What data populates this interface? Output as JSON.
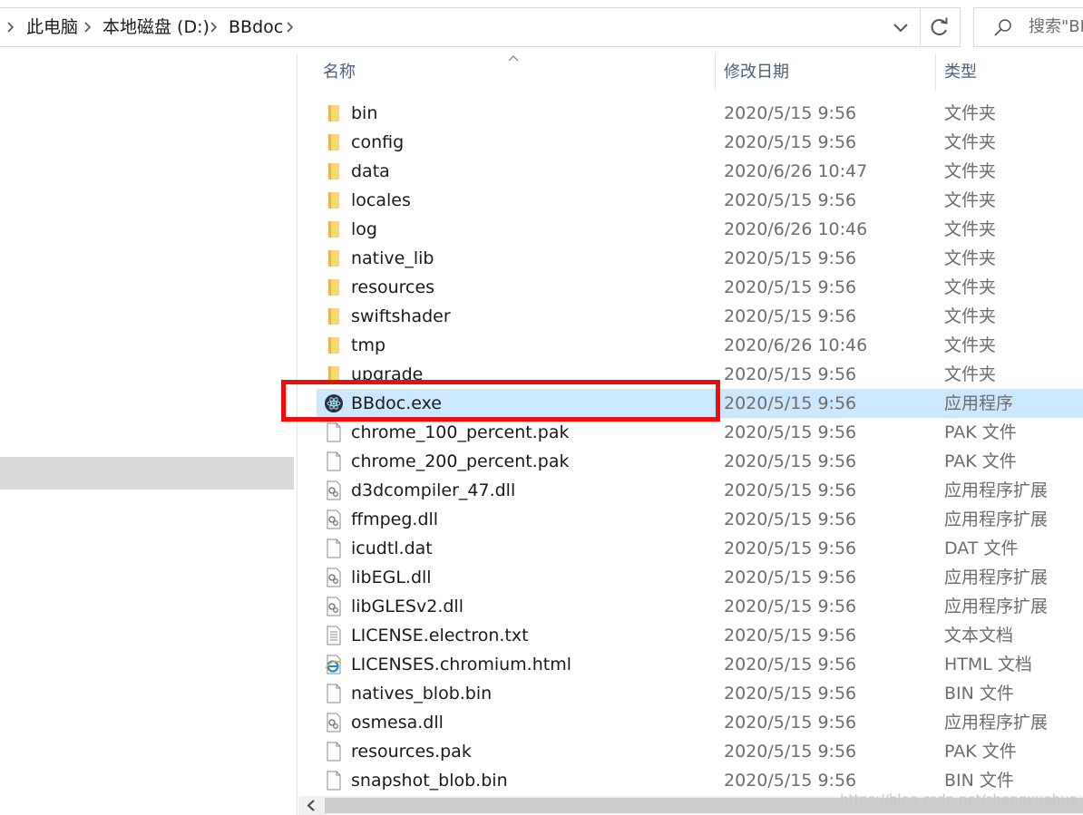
{
  "breadcrumb": {
    "items": [
      "此电脑",
      "本地磁盘 (D:)",
      "BBdoc"
    ]
  },
  "search": {
    "placeholder": "搜索\"BBdoc\"",
    "visible_text": "搜索\"BB"
  },
  "columns": {
    "name": "名称",
    "date": "修改日期",
    "type": "类型"
  },
  "files": [
    {
      "name": "bin",
      "date": "2020/5/15 9:56",
      "type": "文件夹",
      "icon": "folder-icon"
    },
    {
      "name": "config",
      "date": "2020/5/15 9:56",
      "type": "文件夹",
      "icon": "folder-icon"
    },
    {
      "name": "data",
      "date": "2020/6/26 10:47",
      "type": "文件夹",
      "icon": "folder-icon"
    },
    {
      "name": "locales",
      "date": "2020/5/15 9:56",
      "type": "文件夹",
      "icon": "folder-icon"
    },
    {
      "name": "log",
      "date": "2020/6/26 10:46",
      "type": "文件夹",
      "icon": "folder-icon"
    },
    {
      "name": "native_lib",
      "date": "2020/5/15 9:56",
      "type": "文件夹",
      "icon": "folder-icon"
    },
    {
      "name": "resources",
      "date": "2020/5/15 9:56",
      "type": "文件夹",
      "icon": "folder-icon"
    },
    {
      "name": "swiftshader",
      "date": "2020/5/15 9:56",
      "type": "文件夹",
      "icon": "folder-icon"
    },
    {
      "name": "tmp",
      "date": "2020/6/26 10:46",
      "type": "文件夹",
      "icon": "folder-icon"
    },
    {
      "name": "upgrade",
      "date": "2020/5/15 9:56",
      "type": "文件夹",
      "icon": "folder-icon"
    },
    {
      "name": "BBdoc.exe",
      "date": "2020/5/15 9:56",
      "type": "应用程序",
      "icon": "app-icon",
      "selected": true,
      "highlighted": true
    },
    {
      "name": "chrome_100_percent.pak",
      "date": "2020/5/15 9:56",
      "type": "PAK 文件",
      "icon": "file-icon"
    },
    {
      "name": "chrome_200_percent.pak",
      "date": "2020/5/15 9:56",
      "type": "PAK 文件",
      "icon": "file-icon"
    },
    {
      "name": "d3dcompiler_47.dll",
      "date": "2020/5/15 9:56",
      "type": "应用程序扩展",
      "icon": "dll-icon"
    },
    {
      "name": "ffmpeg.dll",
      "date": "2020/5/15 9:56",
      "type": "应用程序扩展",
      "icon": "dll-icon"
    },
    {
      "name": "icudtl.dat",
      "date": "2020/5/15 9:56",
      "type": "DAT 文件",
      "icon": "file-icon"
    },
    {
      "name": "libEGL.dll",
      "date": "2020/5/15 9:56",
      "type": "应用程序扩展",
      "icon": "dll-icon"
    },
    {
      "name": "libGLESv2.dll",
      "date": "2020/5/15 9:56",
      "type": "应用程序扩展",
      "icon": "dll-icon"
    },
    {
      "name": "LICENSE.electron.txt",
      "date": "2020/5/15 9:56",
      "type": "文本文档",
      "icon": "text-file-icon"
    },
    {
      "name": "LICENSES.chromium.html",
      "date": "2020/5/15 9:56",
      "type": "HTML 文档",
      "icon": "ie-html-icon"
    },
    {
      "name": "natives_blob.bin",
      "date": "2020/5/15 9:56",
      "type": "BIN 文件",
      "icon": "file-icon"
    },
    {
      "name": "osmesa.dll",
      "date": "2020/5/15 9:56",
      "type": "应用程序扩展",
      "icon": "dll-icon"
    },
    {
      "name": "resources.pak",
      "date": "2020/5/15 9:56",
      "type": "PAK 文件",
      "icon": "file-icon"
    },
    {
      "name": "snapshot_blob.bin",
      "date": "2020/5/15 9:56",
      "type": "BIN 文件",
      "icon": "file-icon"
    }
  ],
  "watermark": "https://blog.csdn.net/shengxuehua",
  "colors": {
    "selection": "#cce8ff",
    "highlight_border": "#ee0d0d",
    "folder": "#f8d775",
    "header_text": "#4c607a"
  }
}
